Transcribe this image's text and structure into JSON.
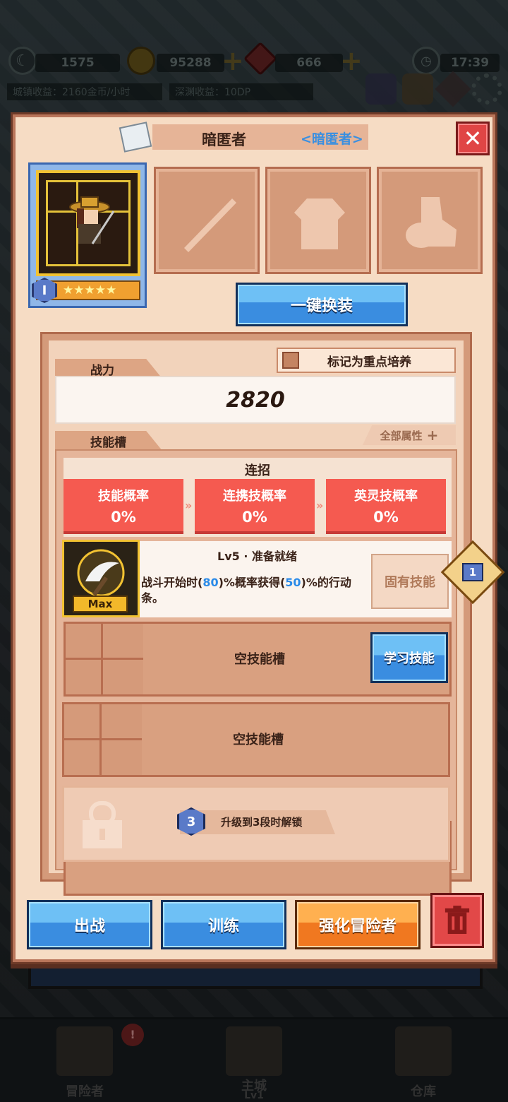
{
  "status_bar": {
    "stat1": "1575",
    "gold": "95288",
    "gems": "666",
    "time": "17:39",
    "town_income": "城镇收益：2160金币/小时",
    "abyss_income": "深渊收益：10DP"
  },
  "bottom_nav": [
    {
      "label": "冒险者"
    },
    {
      "label": "主城",
      "sub": "Lv1"
    },
    {
      "label": "仓库"
    }
  ],
  "modal": {
    "hero_name": "暗匿者",
    "hero_class": "<暗匿者>",
    "close_glyph": "✕",
    "tier": "I",
    "stars": "★★★★★",
    "equip_all_label": "一键换装",
    "mark_training_label": "标记为重点培养",
    "power_tab": "战力",
    "power_value": "2820",
    "all_attributes_label": "全部属性",
    "skill_slot_tab": "技能槽",
    "combo": {
      "title": "连招",
      "items": [
        {
          "label": "技能概率",
          "value": "0%"
        },
        {
          "label": "连携技概率",
          "value": "0%"
        },
        {
          "label": "英灵技概率",
          "value": "0%"
        }
      ]
    },
    "skill": {
      "level": "Lv5 · 准备就绪",
      "desc_pre": "战斗开始时(",
      "desc_num1": "80",
      "desc_mid": ")%概率获得(",
      "desc_num2": "50",
      "desc_post": ")%的行动条。",
      "max_label": "Max",
      "innate_label": "固有技能",
      "badge_count": "1"
    },
    "empty_slot_label": "空技能槽",
    "learn_skill_label": "学习技能",
    "unlock": {
      "badge": "3",
      "text": "升级到3段时解锁"
    },
    "buttons": {
      "deploy": "出战",
      "train": "训练",
      "enhance": "强化冒险者"
    }
  }
}
